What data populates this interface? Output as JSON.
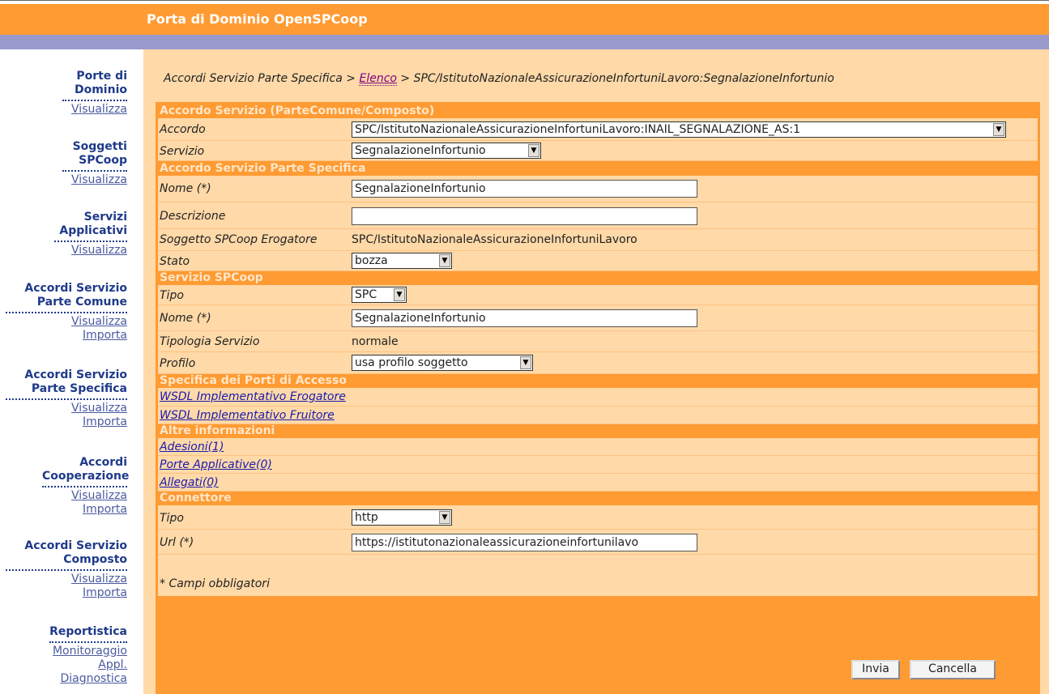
{
  "header": {
    "title": "Porta di Dominio OpenSPCoop"
  },
  "sidebar": {
    "groups": [
      {
        "title": "Porte di Dominio",
        "links": [
          "Visualizza"
        ]
      },
      {
        "title": "Soggetti SPCoop",
        "links": [
          "Visualizza"
        ]
      },
      {
        "title": "Servizi Applicativi",
        "links": [
          "Visualizza"
        ]
      },
      {
        "title": "Accordi Servizio Parte Comune",
        "links": [
          "Visualizza",
          "Importa"
        ]
      },
      {
        "title": "Accordi Servizio Parte Specifica",
        "links": [
          "Visualizza",
          "Importa"
        ]
      },
      {
        "title": "Accordi Cooperazione",
        "links": [
          "Visualizza",
          "Importa"
        ]
      },
      {
        "title": "Accordi Servizio Composto",
        "links": [
          "Visualizza",
          "Importa"
        ]
      },
      {
        "title": "Reportistica",
        "links": [
          "Monitoraggio Appl.",
          "Diagnostica"
        ]
      }
    ]
  },
  "breadcrumb": {
    "part1": "Accordi Servizio Parte Specifica > ",
    "link": "Elenco",
    "part2": " > SPC/IstitutoNazionaleAssicurazioneInfortuniLavoro:SegnalazioneInfortunio"
  },
  "form": {
    "sections": {
      "accordo": "Accordo Servizio (ParteComune/Composto)",
      "parte_specifica": "Accordo Servizio Parte Specifica",
      "servizio": "Servizio SPCoop",
      "porti": "Specifica dei Porti di Accesso",
      "altre": "Altre informazioni",
      "connettore": "Connettore"
    },
    "accordo_label": "Accordo",
    "accordo_value": "SPC/IstitutoNazionaleAssicurazioneInfortuniLavoro:INAIL_SEGNALAZIONE_AS:1",
    "servizio_label": "Servizio",
    "servizio_value": "SegnalazioneInfortunio",
    "nome_label": "Nome (*)",
    "nome_value": "SegnalazioneInfortunio",
    "descrizione_label": "Descrizione",
    "descrizione_value": "",
    "erogatore_label": "Soggetto SPCoop Erogatore",
    "erogatore_value": "SPC/IstitutoNazionaleAssicurazioneInfortuniLavoro",
    "stato_label": "Stato",
    "stato_value": "bozza",
    "tipo_label": "Tipo",
    "tipo_value": "SPC",
    "nome2_label": "Nome (*)",
    "nome2_value": "SegnalazioneInfortunio",
    "tipologia_label": "Tipologia Servizio",
    "tipologia_value": "normale",
    "profilo_label": "Profilo",
    "profilo_value": "usa profilo soggetto",
    "wsdl_erogatore": "WSDL Implementativo Erogatore",
    "wsdl_fruitore": "WSDL Implementativo Fruitore",
    "adesioni": "Adesioni(1)",
    "porte_applicative": "Porte Applicative(0)",
    "allegati": "Allegati(0)",
    "conn_tipo_label": "Tipo",
    "conn_tipo_value": "http",
    "url_label": "Url (*)",
    "url_value": "https://istitutonazionaleassicurazioneinfortunilavo",
    "required_note": "* Campi obbligatori",
    "submit": "Invia",
    "cancel": "Cancella"
  }
}
